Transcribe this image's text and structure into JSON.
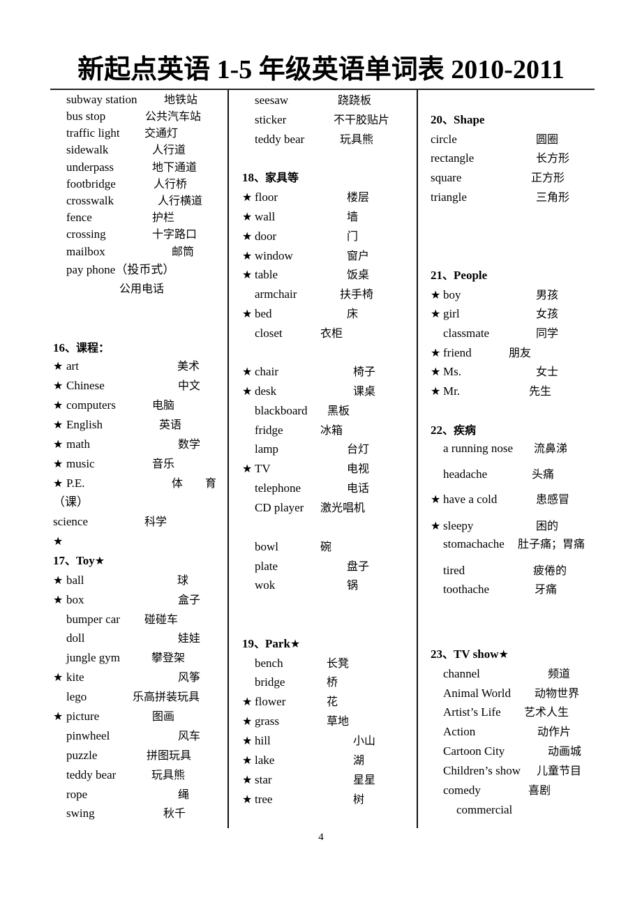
{
  "document": {
    "title": "新起点英语 1-5 年级英语单词表 2010-2011",
    "page_number": "4"
  },
  "columns": [
    {
      "sections": [
        {
          "heading": "",
          "items": [
            {
              "star": false,
              "en": "subway station",
              "zh": "地铁站"
            },
            {
              "star": false,
              "en": "bus stop",
              "zh": "公共汽车站"
            },
            {
              "star": false,
              "en": "traffic light",
              "zh": "交通灯"
            },
            {
              "star": false,
              "en": "sidewalk",
              "zh": "人行道"
            },
            {
              "star": false,
              "en": "underpass",
              "zh": "地下通道"
            },
            {
              "star": false,
              "en": "footbridge",
              "zh": "人行桥"
            },
            {
              "star": false,
              "en": "crosswalk",
              "zh": "人行横道"
            },
            {
              "star": false,
              "en": "fence",
              "zh": "护栏"
            },
            {
              "star": false,
              "en": "crossing",
              "zh": "十字路口"
            },
            {
              "star": false,
              "en": "mailbox",
              "zh": "邮筒"
            },
            {
              "star": false,
              "en": "pay phone（投币式）",
              "zh": ""
            },
            {
              "star": false,
              "en": "",
              "zh": "公用电话"
            }
          ]
        },
        {
          "heading": "16、课程：",
          "items": [
            {
              "star": true,
              "en": "art",
              "zh": "美术"
            },
            {
              "star": true,
              "en": "Chinese",
              "zh": "中文"
            },
            {
              "star": true,
              "en": "computers",
              "zh": "电脑"
            },
            {
              "star": true,
              "en": "English",
              "zh": "英语"
            },
            {
              "star": true,
              "en": "math",
              "zh": "数学"
            },
            {
              "star": true,
              "en": "music",
              "zh": "音乐"
            },
            {
              "star": true,
              "en": "P.E.",
              "zh": "体　　育"
            },
            {
              "star": false,
              "en": "（课）",
              "zh": ""
            },
            {
              "star": false,
              "en": "science",
              "zh": "科学"
            },
            {
              "star": true,
              "en": "",
              "zh": ""
            }
          ]
        },
        {
          "heading": "17、Toy★",
          "items": [
            {
              "star": true,
              "en": "ball",
              "zh": "球"
            },
            {
              "star": true,
              "en": "box",
              "zh": "盒子"
            },
            {
              "star": false,
              "en": "bumper car",
              "zh": "碰碰车"
            },
            {
              "star": false,
              "en": "doll",
              "zh": "娃娃"
            },
            {
              "star": false,
              "en": "jungle gym",
              "zh": "攀登架"
            },
            {
              "star": true,
              "en": "kite",
              "zh": "风筝"
            },
            {
              "star": false,
              "en": "lego",
              "zh": "乐高拼装玩具"
            },
            {
              "star": true,
              "en": "picture",
              "zh": "图画"
            },
            {
              "star": false,
              "en": "pinwheel",
              "zh": "风车"
            },
            {
              "star": false,
              "en": "puzzle",
              "zh": "拼图玩具"
            },
            {
              "star": false,
              "en": "teddy bear",
              "zh": "玩具熊"
            },
            {
              "star": false,
              "en": "rope",
              "zh": "绳"
            },
            {
              "star": false,
              "en": "swing",
              "zh": "秋千"
            }
          ]
        }
      ]
    },
    {
      "sections": [
        {
          "heading": "",
          "items": [
            {
              "star": false,
              "en": "seesaw",
              "zh": "跷跷板"
            },
            {
              "star": false,
              "en": "sticker",
              "zh": "不干胶贴片"
            },
            {
              "star": false,
              "en": "teddy bear",
              "zh": "玩具熊"
            }
          ]
        },
        {
          "heading": "18、家具等",
          "items": [
            {
              "star": true,
              "en": "floor",
              "zh": "楼层"
            },
            {
              "star": true,
              "en": "wall",
              "zh": "墙"
            },
            {
              "star": true,
              "en": "door",
              "zh": "门"
            },
            {
              "star": true,
              "en": "window",
              "zh": "窗户"
            },
            {
              "star": true,
              "en": "table",
              "zh": "饭桌"
            },
            {
              "star": false,
              "en": "armchair",
              "zh": "扶手椅"
            },
            {
              "star": true,
              "en": "bed",
              "zh": "床"
            },
            {
              "star": false,
              "en": "closet",
              "zh": "衣柜"
            },
            {
              "star": true,
              "en": "chair",
              "zh": "椅子"
            },
            {
              "star": true,
              "en": "desk",
              "zh": "课桌"
            },
            {
              "star": false,
              "en": "blackboard",
              "zh": "黑板"
            },
            {
              "star": false,
              "en": "fridge",
              "zh": "冰箱"
            },
            {
              "star": false,
              "en": "lamp",
              "zh": "台灯"
            },
            {
              "star": true,
              "en": "TV",
              "zh": "电视"
            },
            {
              "star": false,
              "en": "telephone",
              "zh": "电话"
            },
            {
              "star": false,
              "en": "CD player",
              "zh": "激光唱机"
            },
            {
              "star": false,
              "en": "bowl",
              "zh": "碗"
            },
            {
              "star": false,
              "en": "plate",
              "zh": "盘子"
            },
            {
              "star": false,
              "en": "wok",
              "zh": "锅"
            }
          ]
        },
        {
          "heading": "19、Park★",
          "items": [
            {
              "star": false,
              "en": "bench",
              "zh": "长凳"
            },
            {
              "star": false,
              "en": "bridge",
              "zh": "桥"
            },
            {
              "star": true,
              "en": "flower",
              "zh": "花"
            },
            {
              "star": true,
              "en": "grass",
              "zh": "草地"
            },
            {
              "star": true,
              "en": "hill",
              "zh": "小山"
            },
            {
              "star": true,
              "en": "lake",
              "zh": "湖"
            },
            {
              "star": true,
              "en": "star",
              "zh": "星星"
            },
            {
              "star": true,
              "en": "tree",
              "zh": "树"
            }
          ]
        }
      ]
    },
    {
      "sections": [
        {
          "heading": "20、Shape",
          "items": [
            {
              "star": false,
              "en": "circle",
              "zh": "圆圈"
            },
            {
              "star": false,
              "en": "rectangle",
              "zh": "长方形"
            },
            {
              "star": false,
              "en": "square",
              "zh": "正方形"
            },
            {
              "star": false,
              "en": "triangle",
              "zh": "三角形"
            }
          ]
        },
        {
          "heading": "21、People",
          "items": [
            {
              "star": true,
              "en": "boy",
              "zh": "男孩"
            },
            {
              "star": true,
              "en": "girl",
              "zh": "女孩"
            },
            {
              "star": false,
              "en": "classmate",
              "zh": "同学"
            },
            {
              "star": true,
              "en": "friend",
              "zh": "朋友"
            },
            {
              "star": true,
              "en": "Ms.",
              "zh": "女士"
            },
            {
              "star": true,
              "en": "Mr.",
              "zh": "先生"
            }
          ]
        },
        {
          "heading": "22、疾病",
          "items": [
            {
              "star": false,
              "en": "a running nose",
              "zh": "流鼻涕"
            },
            {
              "star": false,
              "en": "headache",
              "zh": "头痛"
            },
            {
              "star": true,
              "en": "have a cold",
              "zh": "患感冒"
            },
            {
              "star": true,
              "en": "sleepy",
              "zh": "困的"
            },
            {
              "star": false,
              "en": "stomachache",
              "zh": "肚子痛；胃痛"
            },
            {
              "star": false,
              "en": "tired",
              "zh": "疲倦的"
            },
            {
              "star": false,
              "en": "toothache",
              "zh": "牙痛"
            }
          ]
        },
        {
          "heading": "23、TV show★",
          "items": [
            {
              "star": false,
              "en": "channel",
              "zh": "频道"
            },
            {
              "star": false,
              "en": "Animal World",
              "zh": "动物世界"
            },
            {
              "star": false,
              "en": "Artist’s Life",
              "zh": "艺术人生"
            },
            {
              "star": false,
              "en": "Action",
              "zh": "动作片"
            },
            {
              "star": false,
              "en": "Cartoon City",
              "zh": "动画城"
            },
            {
              "star": false,
              "en": "Children’s show",
              "zh": "儿童节目"
            },
            {
              "star": false,
              "en": "comedy",
              "zh": "喜剧"
            },
            {
              "star": false,
              "en": "commercial",
              "zh": ""
            }
          ]
        }
      ]
    }
  ]
}
